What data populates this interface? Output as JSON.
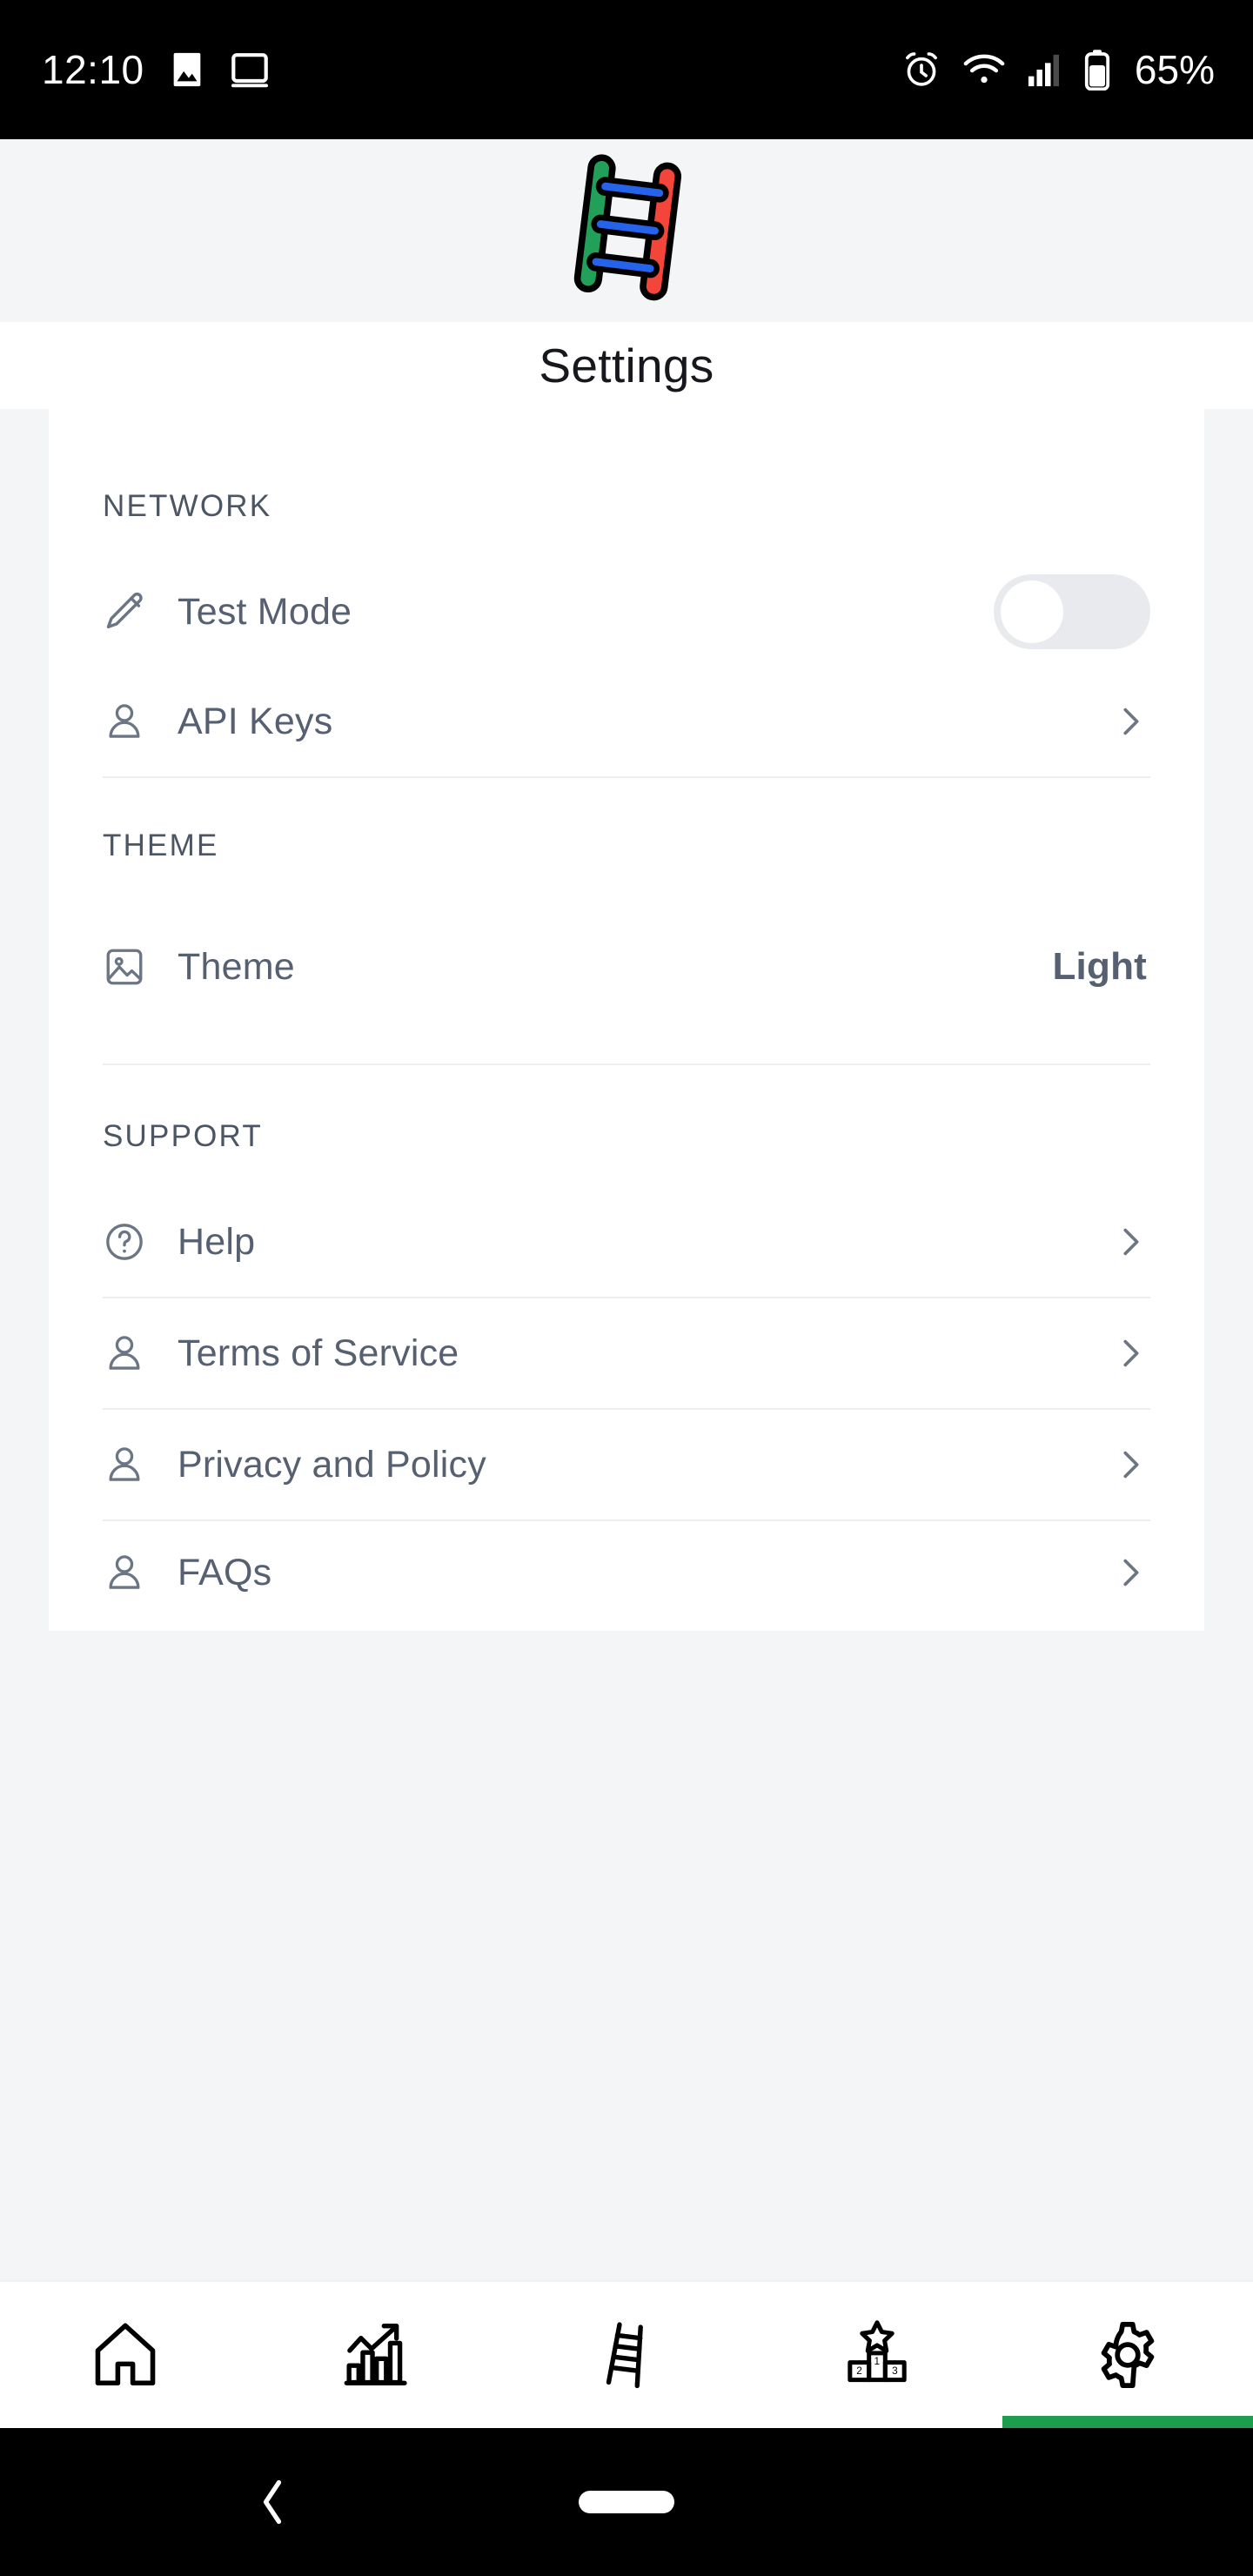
{
  "status_bar": {
    "time": "12:10",
    "battery_percent": "65%",
    "left_icons": [
      "photo-icon",
      "screencast-icon"
    ],
    "right_icons": [
      "alarm-icon",
      "wifi-icon",
      "cellular-signal-icon",
      "battery-icon"
    ]
  },
  "header": {
    "logo_name": "ladder-logo",
    "title": "Settings"
  },
  "colors": {
    "accent_green": "#1d9e4f",
    "logo_green": "#22a05a",
    "logo_red": "#f3453a",
    "logo_blue": "#2563eb",
    "label_text": "#566070",
    "section_text": "#4b5563",
    "page_bg": "#f4f5f7",
    "card_bg": "#ffffff",
    "divider": "#eceef1",
    "toggle_track": "#e8eaee"
  },
  "sections": [
    {
      "id": "network",
      "title": "NETWORK",
      "rows": [
        {
          "id": "test-mode",
          "label": "Test Mode",
          "icon": "pencil-icon",
          "control": "toggle",
          "toggle_on": false
        },
        {
          "id": "api-keys",
          "label": "API Keys",
          "icon": "person-icon",
          "control": "chevron"
        }
      ]
    },
    {
      "id": "theme",
      "title": "THEME",
      "rows": [
        {
          "id": "theme",
          "label": "Theme",
          "icon": "image-icon",
          "control": "value",
          "value": "Light"
        }
      ]
    },
    {
      "id": "support",
      "title": "SUPPORT",
      "rows": [
        {
          "id": "help",
          "label": "Help",
          "icon": "help-circle-icon",
          "control": "chevron"
        },
        {
          "id": "terms",
          "label": "Terms of Service",
          "icon": "person-icon",
          "control": "chevron"
        },
        {
          "id": "privacy",
          "label": "Privacy and Policy",
          "icon": "person-icon",
          "control": "chevron"
        },
        {
          "id": "faqs",
          "label": "FAQs",
          "icon": "person-icon",
          "control": "chevron"
        }
      ]
    }
  ],
  "tab_bar": {
    "active_index": 4,
    "tabs": [
      {
        "id": "home",
        "icon": "home-icon"
      },
      {
        "id": "stats",
        "icon": "bar-chart-icon"
      },
      {
        "id": "ladder",
        "icon": "ladder-icon"
      },
      {
        "id": "leaderboard",
        "icon": "podium-icon"
      },
      {
        "id": "settings",
        "icon": "gear-icon"
      }
    ],
    "podium_labels": [
      "2",
      "1",
      "3"
    ]
  },
  "android_nav": {
    "back": "back-chevron-icon",
    "home": "home-pill-icon"
  }
}
